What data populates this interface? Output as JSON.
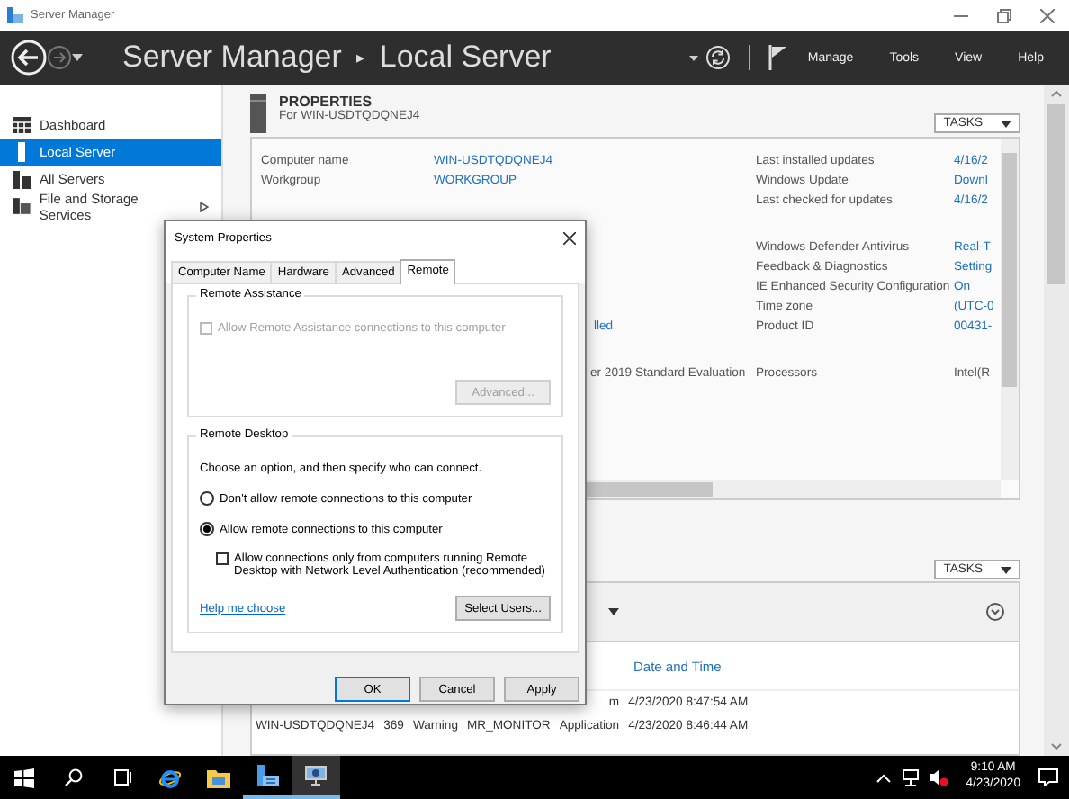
{
  "window": {
    "title": "Server Manager"
  },
  "header": {
    "breadcrumb_root": "Server Manager",
    "separator": "▸",
    "breadcrumb_page": "Local Server",
    "menu": [
      "Manage",
      "Tools",
      "View",
      "Help"
    ]
  },
  "sidebar": {
    "items": [
      {
        "label": "Dashboard",
        "selected": false,
        "has_children": false
      },
      {
        "label": "Local Server",
        "selected": true,
        "has_children": false
      },
      {
        "label": "All Servers",
        "selected": false,
        "has_children": false
      },
      {
        "label": "File and Storage Services",
        "selected": false,
        "has_children": true
      }
    ]
  },
  "properties": {
    "title": "PROPERTIES",
    "subtitle": "For WIN-USDTQDQNEJ4",
    "tasks": "TASKS",
    "sections": [
      {
        "rows": [
          {
            "label": "Computer name",
            "value": "WIN-USDTQDQNEJ4",
            "right_label": "Last installed updates",
            "right_value": "4/16/2"
          },
          {
            "label": "Workgroup",
            "value": "WORKGROUP",
            "right_label": "Windows Update",
            "right_value": "Downl"
          },
          {
            "right_label": "Last checked for updates",
            "right_value": "4/16/2"
          }
        ]
      },
      {
        "rows": [
          {
            "right_label": "Windows Defender Antivirus",
            "right_value": "Real-T"
          },
          {
            "right_label": "Feedback & Diagnostics",
            "right_value": "Setting"
          },
          {
            "right_label": "IE Enhanced Security Configuration",
            "right_value": "On"
          },
          {
            "right_label": "Time zone",
            "right_value": "(UTC-0"
          },
          {
            "value": "lled",
            "partial": true,
            "right_label": "Product ID",
            "right_value": "00431-"
          }
        ]
      },
      {
        "rows": [
          {
            "value": "er 2019 Standard Evaluation",
            "partial": true,
            "value_link": false,
            "right_label": "Processors",
            "right_value": "Intel(R",
            "right_link": false
          }
        ]
      }
    ]
  },
  "events": {
    "tasks": "TASKS",
    "date_column": "Date and Time",
    "rows": [
      {
        "log": "m",
        "date": "4/23/2020 8:47:54 AM"
      },
      {
        "server": "WIN-USDTQDQNEJ4",
        "id": "369",
        "severity": "Warning",
        "source": "MR_MONITOR",
        "log": "Application",
        "date": "4/23/2020 8:46:44 AM"
      }
    ]
  },
  "dialog": {
    "title": "System Properties",
    "tabs": [
      {
        "label": "Computer Name",
        "selected": false
      },
      {
        "label": "Hardware",
        "selected": false
      },
      {
        "label": "Advanced",
        "selected": false
      },
      {
        "label": "Remote",
        "selected": true
      }
    ],
    "remote_assistance": {
      "title": "Remote Assistance",
      "checkbox": {
        "label": "Allow Remote Assistance connections to this computer",
        "checked": false,
        "disabled": true
      },
      "button": {
        "label": "Advanced...",
        "disabled": true
      }
    },
    "remote_desktop": {
      "title": "Remote Desktop",
      "instruction": "Choose an option, and then specify who can connect.",
      "options": [
        {
          "label": "Don't allow remote connections to this computer",
          "selected": false
        },
        {
          "label": "Allow remote connections to this computer",
          "selected": true
        }
      ],
      "nla_checkbox": {
        "label": "Allow connections only from computers running Remote Desktop with Network Level Authentication (recommended)",
        "checked": false
      },
      "help_link": "Help me choose",
      "select_users": "Select Users..."
    },
    "buttons": [
      {
        "label": "OK",
        "default": true
      },
      {
        "label": "Cancel",
        "default": false
      },
      {
        "label": "Apply",
        "default": false
      }
    ]
  },
  "taskbar": {
    "time": "9:10 AM",
    "date": "4/23/2020"
  }
}
